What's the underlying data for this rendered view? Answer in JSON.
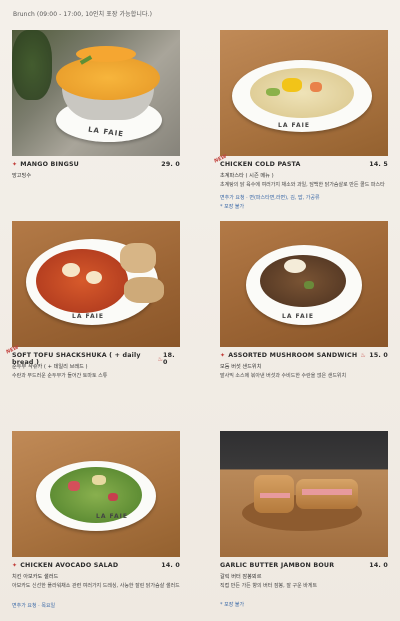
{
  "hours": "Brunch (09:00 - 17:00, 10인치 포장 가능합니다.)",
  "items": [
    {
      "name": "MANGO BINGSU",
      "price": "29. 0",
      "sub1": "망고빙수",
      "sub2": "",
      "notes": [],
      "badge": "",
      "spicy": false
    },
    {
      "name": "CHICKEN COLD PASTA",
      "price": "14. 5",
      "sub1": "초계파스타 ( 시즌 메뉴 )",
      "sub2": "초계탕의 닭 육수에 여러가지 채소와 과일, 담백한 닭가슴살로 만든 콜드 파스타",
      "notes": [
        "면추가 요청 · 면(파스타면,라면), 김, 밥, 가공류",
        "* 포장 불가"
      ],
      "badge": "NEW",
      "spicy": false
    },
    {
      "name": "SOFT TOFU SHACKSHUKA ( + daily bread )",
      "price": "18. 0",
      "sub1": "순두부 샥슈카 ( + 데일리 브레드 )",
      "sub2": "수란과 부드러운 순두부가 들어간 토마토 스튜",
      "notes": [],
      "badge": "NEW",
      "spicy": true
    },
    {
      "name": "ASSORTED MUSHROOM SANDWICH",
      "price": "15. 0",
      "sub1": "모둠 버섯 샌드위치",
      "sub2": "발사믹 소스에 볶아낸 버섯과 수비드한 수란을 얹은 샌드위치",
      "notes": [],
      "badge": "",
      "spicy": true
    },
    {
      "name": "CHICKEN AVOCADO SALAD",
      "price": "14. 0",
      "sub1": "치킨 아보카도 샐러드",
      "sub2": "아보카도 신선한 플라워채소 관련 여러가지 드레싱, 사능한 잘린 닭가슴살 샐러드",
      "notes": [
        "면추가 요청 · 목요일"
      ],
      "badge": "",
      "spicy": false
    },
    {
      "name": "GARLIC BUTTER JAMBON BOUR",
      "price": "14. 0",
      "sub1": "갈릭 버터 잠봉뵈르",
      "sub2": "직접 만든 가든 향의 버터 잠봉, 잘 구운 바게트",
      "notes": [
        "* 포장 불가"
      ],
      "badge": "",
      "spicy": false
    }
  ],
  "plate_brand": "LA FAIE",
  "colors": {
    "accent": "#c2403c",
    "note": "#3d6ba8"
  }
}
